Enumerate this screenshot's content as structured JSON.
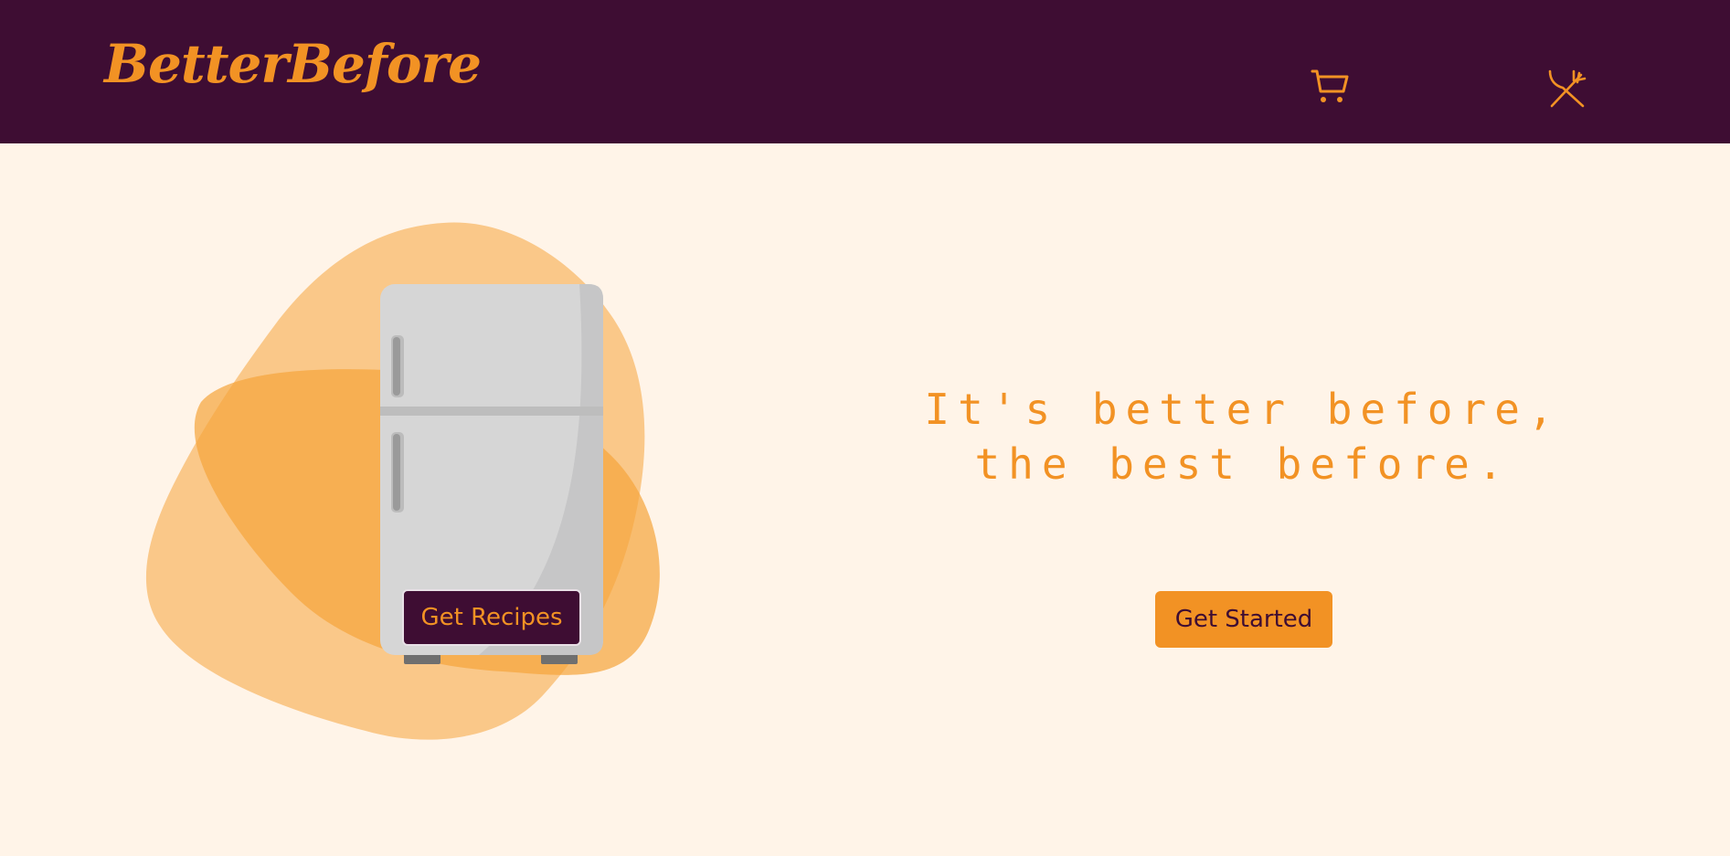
{
  "header": {
    "logo": "BetterBefore",
    "icons": [
      "cart-icon",
      "utensils-icon"
    ]
  },
  "hero": {
    "tagline_line1": "It's better before,",
    "tagline_line2": "the best before.",
    "get_started_label": "Get Started",
    "get_recipes_label": "Get Recipes"
  },
  "colors": {
    "header_bg": "#3e0d33",
    "accent": "#f29224",
    "page_bg": "#fff4e8",
    "blob": "#f5a43a"
  }
}
